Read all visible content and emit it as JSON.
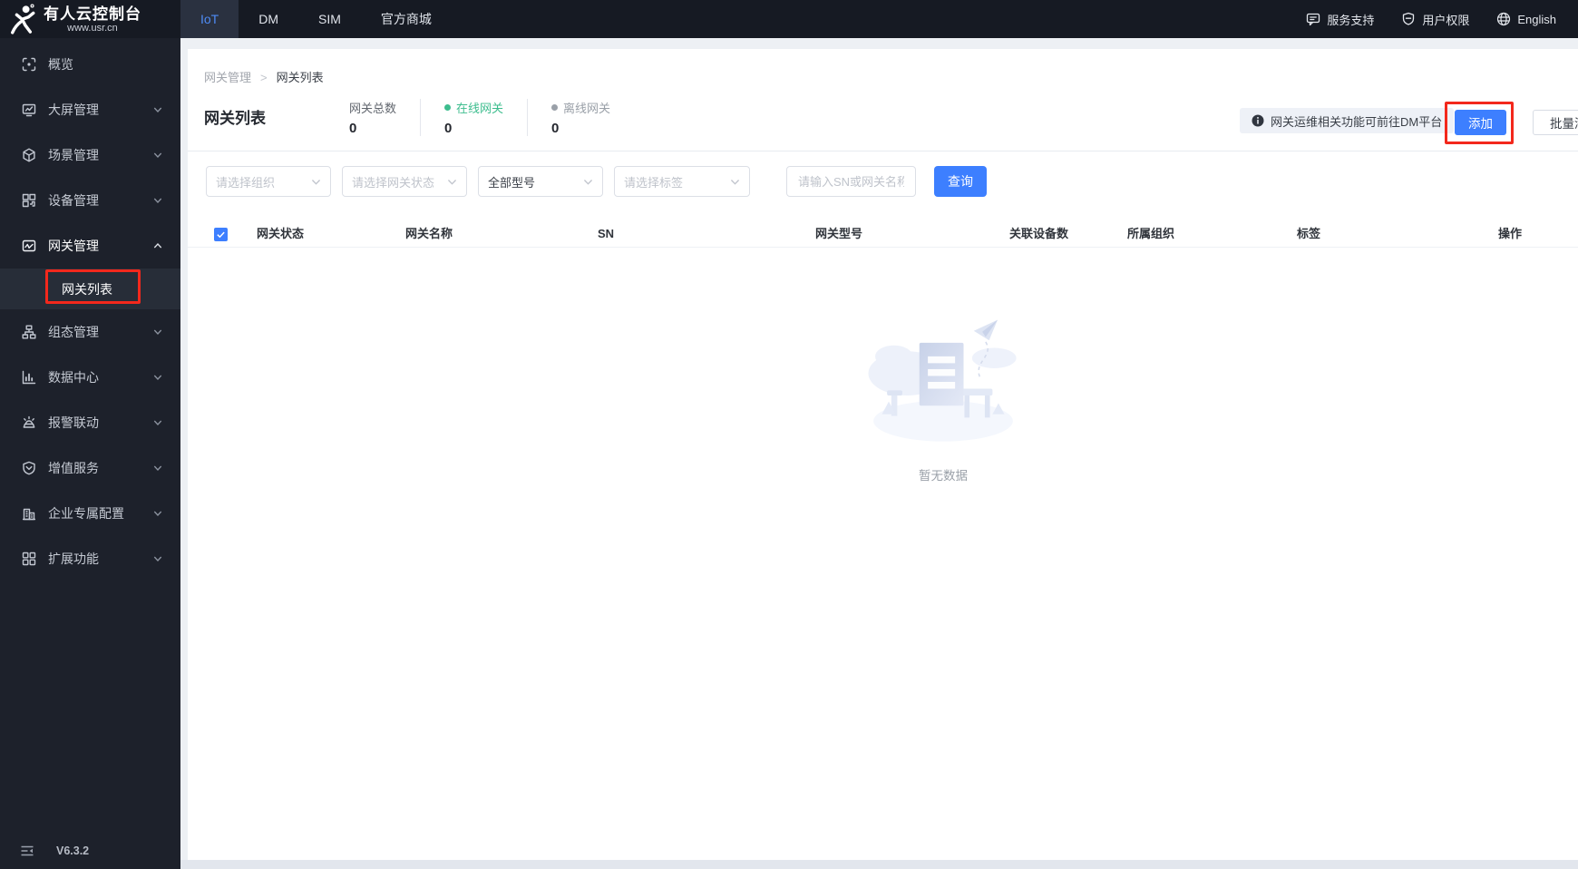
{
  "topbar": {
    "logo": {
      "title": "有人云控制台",
      "subtitle": "www.usr.cn"
    },
    "tabs": [
      {
        "label": "IoT",
        "active": true
      },
      {
        "label": "DM"
      },
      {
        "label": "SIM"
      },
      {
        "label": "官方商城"
      }
    ],
    "right": [
      {
        "label": "服务支持",
        "icon": "chat-icon"
      },
      {
        "label": "用户权限",
        "icon": "shield-icon"
      },
      {
        "label": "English",
        "icon": "globe-icon"
      }
    ]
  },
  "sidebar": {
    "items": [
      {
        "label": "概览",
        "icon": "overview-icon"
      },
      {
        "label": "大屏管理",
        "icon": "bigscreen-icon",
        "chevron": "down"
      },
      {
        "label": "场景管理",
        "icon": "scene-icon",
        "chevron": "down"
      },
      {
        "label": "设备管理",
        "icon": "device-icon",
        "chevron": "down"
      },
      {
        "label": "网关管理",
        "icon": "gateway-icon",
        "chevron": "up",
        "expanded": true
      },
      {
        "label": "网关列表",
        "type": "sub",
        "active": true
      },
      {
        "label": "组态管理",
        "icon": "topology-icon",
        "chevron": "down"
      },
      {
        "label": "数据中心",
        "icon": "datacenter-icon",
        "chevron": "down"
      },
      {
        "label": "报警联动",
        "icon": "alarm-icon",
        "chevron": "down"
      },
      {
        "label": "增值服务",
        "icon": "vas-icon",
        "chevron": "down"
      },
      {
        "label": "企业专属配置",
        "icon": "enterprise-icon",
        "chevron": "down"
      },
      {
        "label": "扩展功能",
        "icon": "extension-icon",
        "chevron": "down"
      }
    ],
    "version": "V6.3.2"
  },
  "breadcrumb": {
    "items": [
      "网关管理",
      "网关列表"
    ],
    "separator": ">"
  },
  "page": {
    "title": "网关列表",
    "stats": [
      {
        "label": "网关总数",
        "value": "0"
      },
      {
        "label": "在线网关",
        "value": "0",
        "dot": "#3dbd8e",
        "color": "#3dbd8e"
      },
      {
        "label": "离线网关",
        "value": "0",
        "dot": "#9aa0a8",
        "color": "#9aa0a8"
      }
    ],
    "notice": "网关运维相关功能可前往DM平台",
    "add_button": "添加",
    "batch_add_button": "批量添加",
    "filters": {
      "selects": [
        {
          "value": "请选择组织",
          "placeholder": true
        },
        {
          "value": "请选择网关状态",
          "placeholder": true
        },
        {
          "value": "全部型号",
          "placeholder": false
        },
        {
          "value": "请选择标签",
          "placeholder": true
        }
      ],
      "search_placeholder": "请输入SN或网关名称",
      "query_button": "查询"
    },
    "table": {
      "columns": [
        "网关状态",
        "网关名称",
        "SN",
        "网关型号",
        "关联设备数",
        "所属组织",
        "标签",
        "操作"
      ]
    },
    "empty_text": "暂无数据"
  },
  "colors": {
    "accent": "#3d7fff",
    "online_green": "#3dbd8e",
    "offline_gray": "#9aa0a8",
    "annotation_red": "#f3281c"
  }
}
